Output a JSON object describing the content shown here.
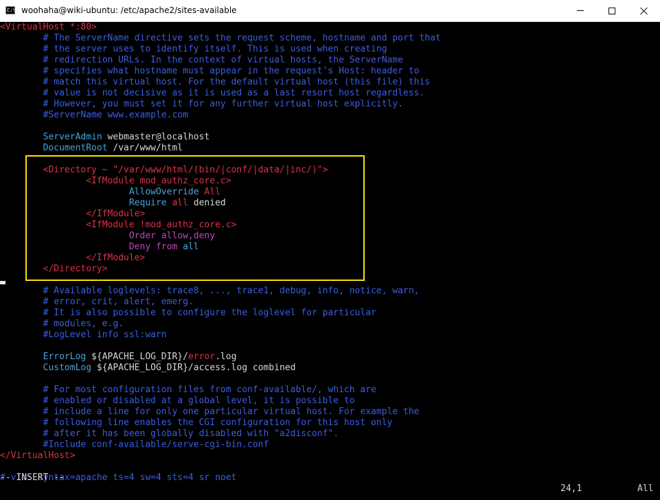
{
  "window": {
    "title": "woohaha@wiki-ubuntu: /etc/apache2/sites-available",
    "icon_label": "C:\\"
  },
  "editor": {
    "mode": "-- INSERT --",
    "cursor_position": "24,1",
    "scroll_position": "All"
  },
  "colors": {
    "comment": "#3b5ee0",
    "directive": "#4aa3d8",
    "tag": "#dd3344",
    "text": "#d8d8d8",
    "purple": "#b94ab9",
    "highlight": "#ffe000"
  },
  "lines": [
    [
      {
        "t": "<VirtualHost *:80>",
        "c": "tg"
      }
    ],
    [
      {
        "t": "        # The ServerName directive sets the request scheme, hostname and port that",
        "c": "cm"
      }
    ],
    [
      {
        "t": "        # the server uses to identify itself. This is used when creating",
        "c": "cm"
      }
    ],
    [
      {
        "t": "        # redirection URLs. In the context of virtual hosts, the ServerName",
        "c": "cm"
      }
    ],
    [
      {
        "t": "        # specifies what hostname must appear in the request's Host: header to",
        "c": "cm"
      }
    ],
    [
      {
        "t": "        # match this virtual host. For the default virtual host (this file) this",
        "c": "cm"
      }
    ],
    [
      {
        "t": "        # value is not decisive as it is used as a last resort host regardless.",
        "c": "cm"
      }
    ],
    [
      {
        "t": "        # However, you must set it for any further virtual host explicitly.",
        "c": "cm"
      }
    ],
    [
      {
        "t": "        #ServerName www.example.com",
        "c": "cm"
      }
    ],
    [],
    [
      {
        "t": "        ServerAdmin",
        "c": "kw"
      },
      {
        "t": " webmaster@localhost",
        "c": "tx"
      }
    ],
    [
      {
        "t": "        DocumentRoot",
        "c": "kw"
      },
      {
        "t": " /var/www/html",
        "c": "tx"
      }
    ],
    [],
    [
      {
        "t": "        <Directory ~ \"/var/www/html/(bin/|conf/|data/|inc/)\">",
        "c": "tg"
      }
    ],
    [
      {
        "t": "                <IfModule mod_authz_core.c>",
        "c": "tg"
      }
    ],
    [
      {
        "t": "                        AllowOverride",
        "c": "kw"
      },
      {
        "t": " All",
        "c": "tg"
      }
    ],
    [
      {
        "t": "                        Require",
        "c": "kw"
      },
      {
        "t": " all",
        "c": "tg"
      },
      {
        "t": " denied",
        "c": "tx"
      }
    ],
    [
      {
        "t": "                </IfModule>",
        "c": "tg"
      }
    ],
    [
      {
        "t": "                <IfModule !mod_authz_core.c>",
        "c": "tg"
      }
    ],
    [
      {
        "t": "                        Order allow,deny",
        "c": "pu"
      }
    ],
    [
      {
        "t": "                        Deny",
        "c": "pu"
      },
      {
        "t": " from",
        "c": "pu"
      },
      {
        "t": " all",
        "c": "kw"
      }
    ],
    [
      {
        "t": "                </IfModule>",
        "c": "tg"
      }
    ],
    [
      {
        "t": "        </Directory>",
        "c": "tg"
      }
    ],
    [],
    [
      {
        "t": "        # Available loglevels: trace8, ..., trace1, debug, info, notice, warn,",
        "c": "cm"
      }
    ],
    [
      {
        "t": "        # error, crit, alert, emerg.",
        "c": "cm"
      }
    ],
    [
      {
        "t": "        # It is also possible to configure the loglevel for particular",
        "c": "cm"
      }
    ],
    [
      {
        "t": "        # modules, e.g.",
        "c": "cm"
      }
    ],
    [
      {
        "t": "        #LogLevel info ssl:warn",
        "c": "cm"
      }
    ],
    [],
    [
      {
        "t": "        ErrorLog",
        "c": "kw"
      },
      {
        "t": " ${APACHE_LOG_DIR}/",
        "c": "tx"
      },
      {
        "t": "error",
        "c": "tg"
      },
      {
        "t": ".log",
        "c": "tx"
      }
    ],
    [
      {
        "t": "        CustomLog",
        "c": "kw"
      },
      {
        "t": " ${APACHE_LOG_DIR}/access.log combined",
        "c": "tx"
      }
    ],
    [],
    [
      {
        "t": "        # For most configuration files from conf-available/, which are",
        "c": "cm"
      }
    ],
    [
      {
        "t": "        # enabled or disabled at a global level, it is possible to",
        "c": "cm"
      }
    ],
    [
      {
        "t": "        # include a line for only one particular virtual host. For example the",
        "c": "cm"
      }
    ],
    [
      {
        "t": "        # following line enables the CGI configuration for this host only",
        "c": "cm"
      }
    ],
    [
      {
        "t": "        # after it has been globally disabled with \"a2disconf\".",
        "c": "cm"
      }
    ],
    [
      {
        "t": "        #Include conf-available/serve-cgi-bin.conf",
        "c": "cm"
      }
    ],
    [
      {
        "t": "</VirtualHost>",
        "c": "tg"
      }
    ],
    [],
    [
      {
        "t": "# vim: syntax=apache ts=4 sw=4 sts=4 sr noet",
        "c": "cm"
      }
    ]
  ]
}
